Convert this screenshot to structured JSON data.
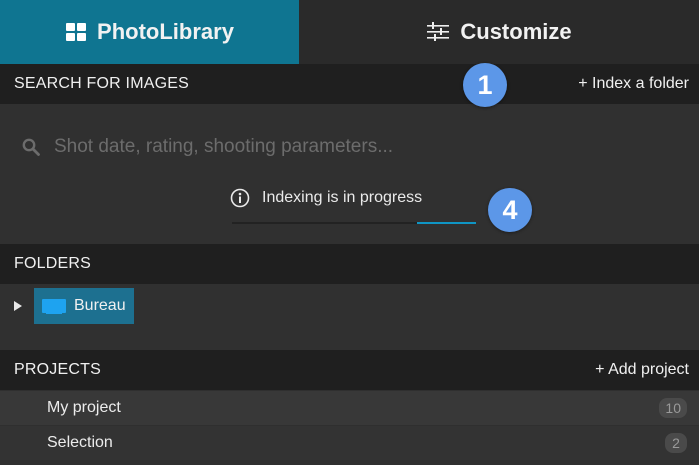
{
  "tabs": [
    {
      "label": "PhotoLibrary",
      "icon": "grid-icon",
      "active": true
    },
    {
      "label": "Customize",
      "icon": "sliders-icon",
      "active": false
    }
  ],
  "search_section": {
    "title": "SEARCH FOR IMAGES",
    "action": "+ Index a folder",
    "placeholder": "Shot date, rating, shooting parameters...",
    "status": "Indexing is in progress",
    "progress": 0.24
  },
  "folders_section": {
    "title": "FOLDERS",
    "items": [
      {
        "label": "Bureau"
      }
    ]
  },
  "projects_section": {
    "title": "PROJECTS",
    "action": "+ Add project",
    "items": [
      {
        "label": "My project",
        "count": "10"
      },
      {
        "label": "Selection",
        "count": "2"
      }
    ]
  },
  "markers": [
    "1",
    "4"
  ],
  "colors": {
    "accent": "#0f7591",
    "progress": "#0f95c4",
    "marker": "#5c97e8",
    "header": "#1f1f1f",
    "panel": "#303030"
  }
}
